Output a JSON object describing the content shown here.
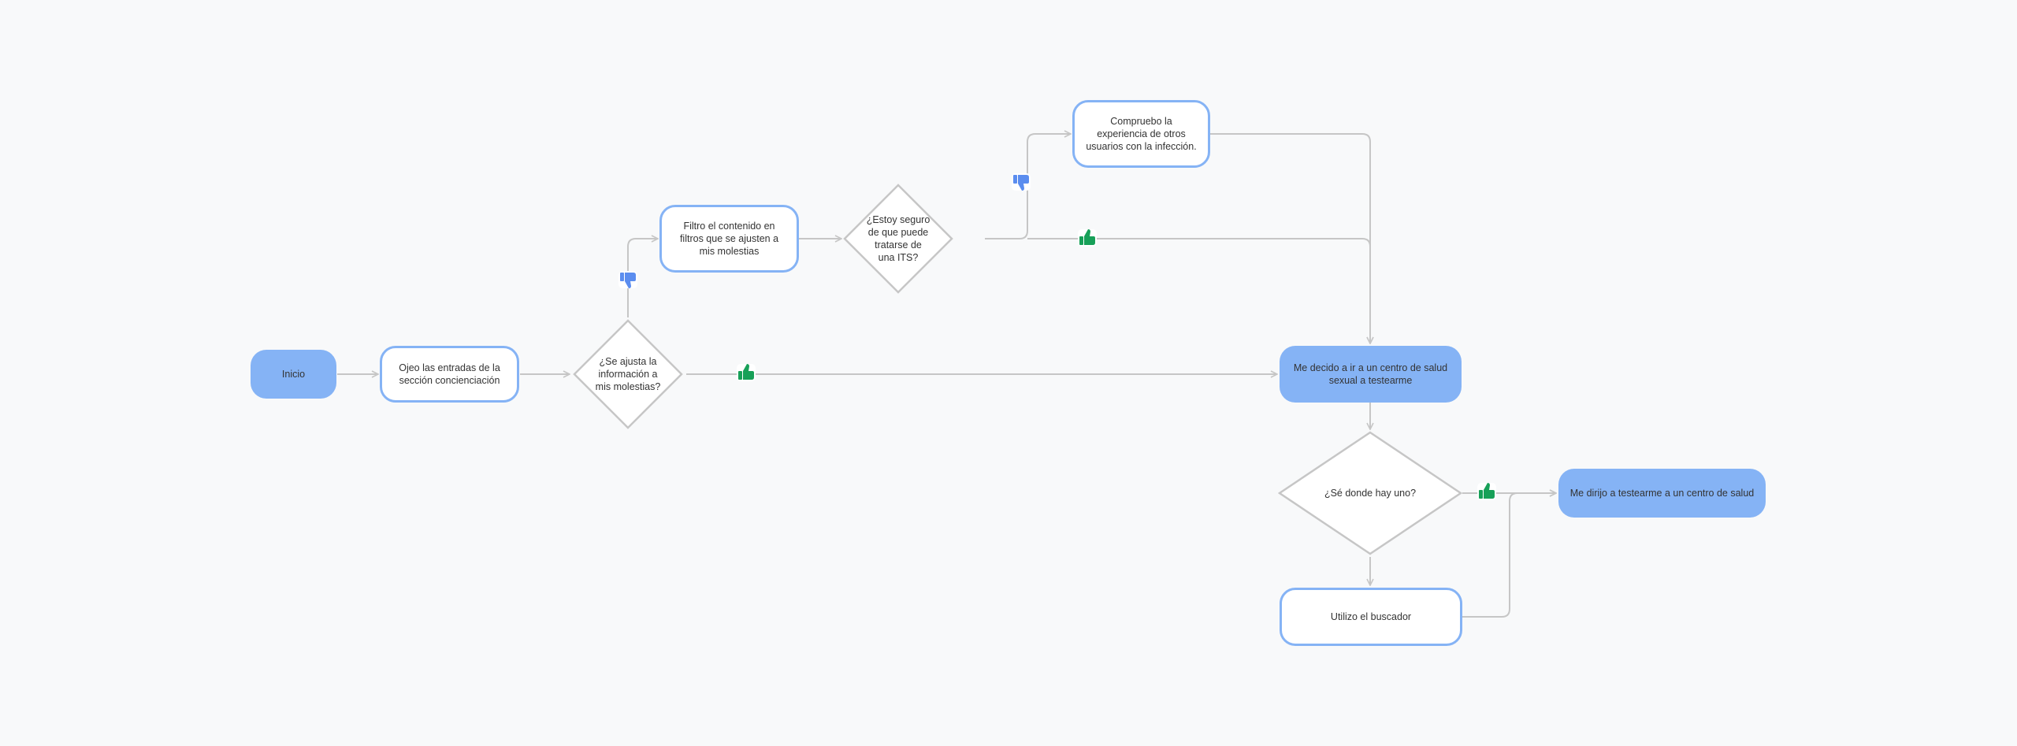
{
  "nodes": {
    "inicio": "Inicio",
    "ojeo": "Ojeo las entradas de la sección concienciación",
    "se_ajusta": "¿Se ajusta la información a mis molestias?",
    "filtro": "Filtro el contenido en filtros que se ajusten a mis molestias",
    "estoy_seguro": "¿Estoy seguro de que puede tratarse de una ITS?",
    "compruebo": "Compruebo la experiencia de otros usuarios con la infección.",
    "me_decido": "Me decido a ir a un centro de salud sexual a testearme",
    "se_donde": "¿Sé donde hay uno?",
    "utilizo": "Utilizo el buscador",
    "me_dirijo": "Me dirijo a testearme a un centro de salud"
  },
  "icons": {
    "yes": "thumbs-up-icon",
    "no": "thumbs-down-icon"
  },
  "colors": {
    "node_fill": "#85b3f5",
    "node_border": "#85b3f5",
    "connector": "#c6c6c6",
    "yes": "#17a058",
    "no": "#5b8def"
  }
}
